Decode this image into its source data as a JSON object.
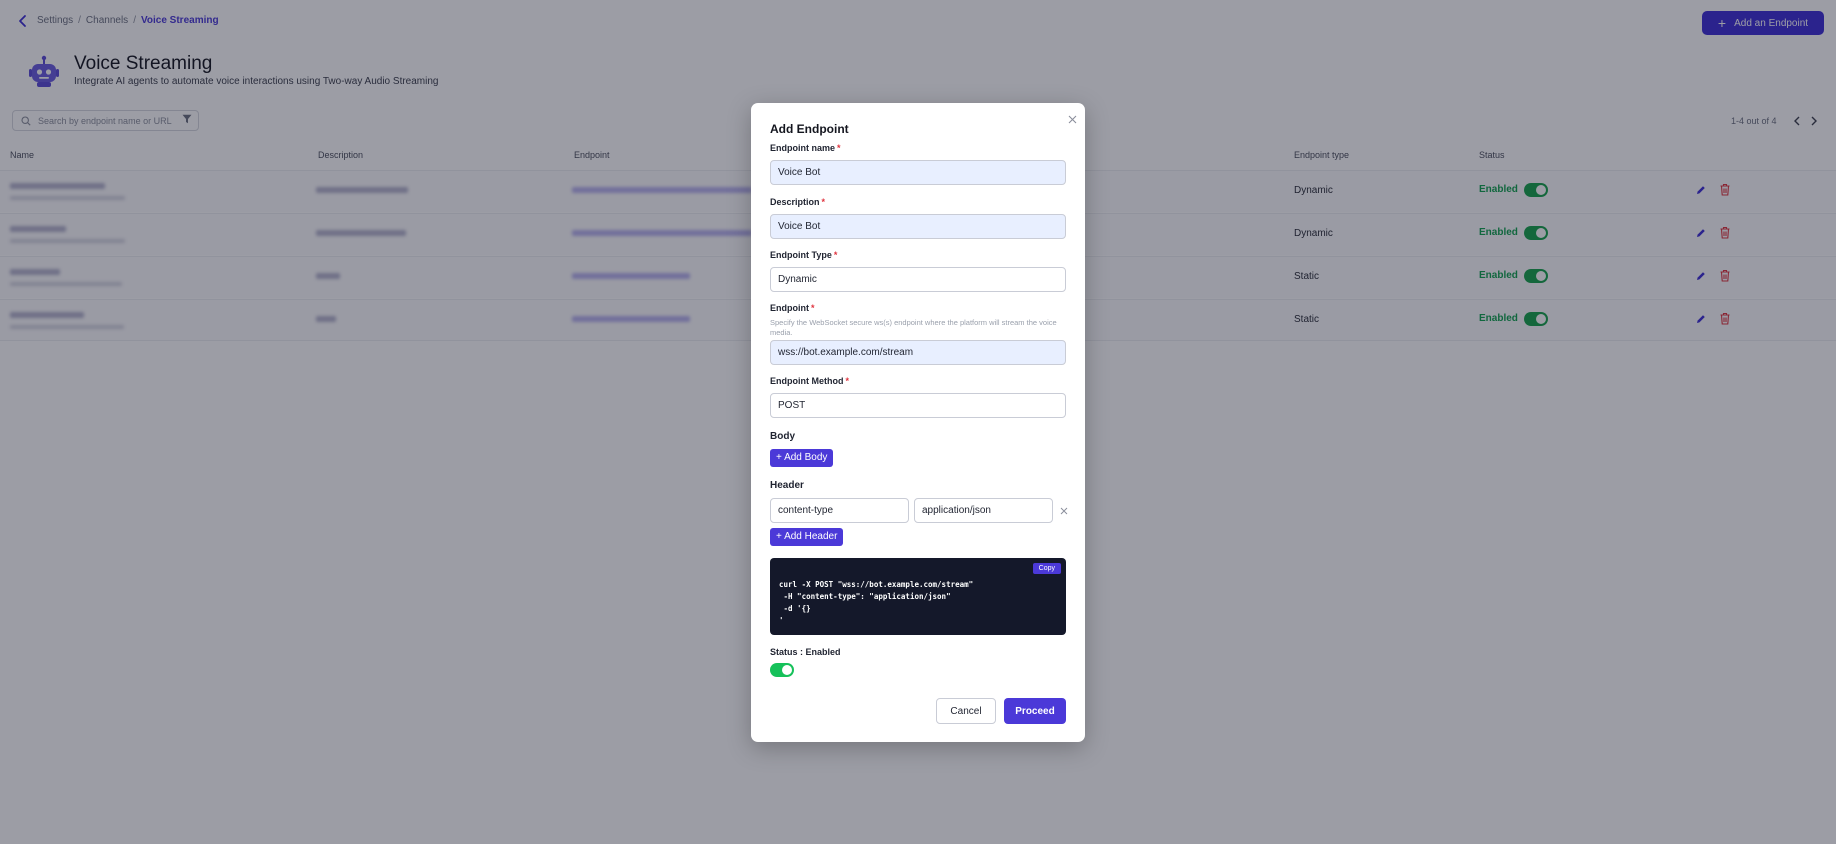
{
  "breadcrumb": {
    "items": [
      "Settings",
      "Channels"
    ],
    "current": "Voice Streaming",
    "separator": "/"
  },
  "header": {
    "title": "Voice Streaming",
    "subtitle": "Integrate AI agents to automate voice interactions using Two-way Audio Streaming",
    "add_button_label": "Add an Endpoint",
    "add_button_icon": "plus-icon"
  },
  "search": {
    "placeholder": "Search by endpoint name or URL"
  },
  "pagination": {
    "text": "1-4 out of 4"
  },
  "table": {
    "columns": [
      "Name",
      "Description",
      "Endpoint",
      "Endpoint type",
      "Status"
    ],
    "rows": [
      {
        "endpoint_type": "Dynamic",
        "status": "Enabled",
        "enabled": true
      },
      {
        "endpoint_type": "Dynamic",
        "status": "Enabled",
        "enabled": true
      },
      {
        "endpoint_type": "Static",
        "status": "Enabled",
        "enabled": true
      },
      {
        "endpoint_type": "Static",
        "status": "Enabled",
        "enabled": true
      }
    ]
  },
  "modal": {
    "title": "Add Endpoint",
    "fields": {
      "name": {
        "label": "Endpoint name",
        "value": "Voice Bot",
        "required": "*"
      },
      "description": {
        "label": "Description",
        "value": "Voice Bot",
        "required": "*"
      },
      "type": {
        "label": "Endpoint Type",
        "value": "Dynamic",
        "required": "*"
      },
      "endpoint": {
        "label": "Endpoint",
        "required": "*",
        "hint": "Specify the WebSocket secure ws(s) endpoint where the platform will stream the voice media.",
        "value": "wss://bot.example.com/stream"
      },
      "method": {
        "label": "Endpoint Method",
        "value": "POST",
        "required": "*"
      }
    },
    "body": {
      "title": "Body",
      "add_label": "+ Add Body"
    },
    "header": {
      "title": "Header",
      "key": "content-type",
      "value": "application/json",
      "add_label": "+ Add Header"
    },
    "code": {
      "copy_label": "Copy",
      "lines": [
        "curl -X POST \"wss://bot.example.com/stream\"",
        " -H \"content-type\": \"application/json\"",
        " -d '{}",
        "'"
      ]
    },
    "status": {
      "label": "Status : Enabled",
      "enabled": true
    },
    "cancel_label": "Cancel",
    "proceed_label": "Proceed"
  },
  "colors": {
    "accent": "#4b39d8",
    "enabled": "#16a34a",
    "required": "#e0343f",
    "code_bg": "#14182a"
  }
}
